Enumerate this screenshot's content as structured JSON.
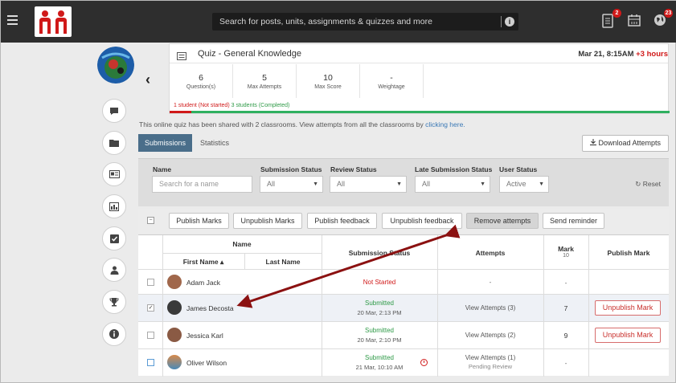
{
  "topbar": {
    "search_placeholder": "Search for posts, units, assignments & quizzes and more",
    "notifications_badge": "2",
    "alerts_badge": "23",
    "colors": {
      "bar": "#2e2e2e",
      "logo": "#d01919"
    }
  },
  "quiz": {
    "title": "Quiz - General Knowledge",
    "date": "Mar 21, 8:15AM",
    "extra_time": "+3 hours",
    "stats": [
      {
        "value": "6",
        "label": "Question(s)"
      },
      {
        "value": "5",
        "label": "Max Attempts"
      },
      {
        "value": "10",
        "label": "Max Score"
      },
      {
        "value": "-",
        "label": "Weightage"
      }
    ],
    "status_not_started": "1 student (Not started)",
    "status_completed": "3 students (Completed)"
  },
  "shared_note": {
    "text": "This online quiz has been shared with 2 classrooms. View attempts from all the classrooms by ",
    "link": "clicking here."
  },
  "tabs": {
    "submissions": "Submissions",
    "statistics": "Statistics"
  },
  "download_label": "Download Attempts",
  "filters": {
    "name_label": "Name",
    "name_placeholder": "Search for a name",
    "submission_status_label": "Submission Status",
    "submission_status_value": "All",
    "review_status_label": "Review Status",
    "review_status_value": "All",
    "late_status_label": "Late Submission Status",
    "late_status_value": "All",
    "user_status_label": "User Status",
    "user_status_value": "Active",
    "reset_label": "Reset"
  },
  "actions": [
    "Publish Marks",
    "Unpublish Marks",
    "Publish feedback",
    "Unpublish feedback",
    "Remove attempts",
    "Send reminder"
  ],
  "table": {
    "headers": {
      "name": "Name",
      "first_name": "First Name ▴",
      "last_name": "Last Name",
      "submission_status": "Submission Status",
      "attempts": "Attempts",
      "mark": "Mark",
      "mark_max": "10",
      "publish_mark": "Publish Mark"
    },
    "rows": [
      {
        "name": "Adam Jack",
        "status": "Not Started",
        "date": "",
        "attempts": "-",
        "pending": "",
        "mark": "-",
        "publish": "",
        "checked": false
      },
      {
        "name": "James Decosta",
        "status": "Submitted",
        "date": "20 Mar, 2:13 PM",
        "attempts": "View Attempts (3)",
        "pending": "",
        "mark": "7",
        "publish": "Unpublish Mark",
        "checked": true
      },
      {
        "name": "Jessica Karl",
        "status": "Submitted",
        "date": "20 Mar, 2:10 PM",
        "attempts": "View Attempts (2)",
        "pending": "",
        "mark": "9",
        "publish": "Unpublish Mark",
        "checked": false
      },
      {
        "name": "Oliver Wilson",
        "status": "Submitted",
        "date": "21 Mar, 10:10 AM",
        "attempts": "View Attempts (1)",
        "pending": "Pending Review",
        "mark": "-",
        "publish": "",
        "checked": false
      }
    ]
  },
  "rail_icons": [
    "chat-icon",
    "folder-icon",
    "id-card-icon",
    "bar-chart-icon",
    "checkbox-icon",
    "user-icon",
    "trophy-icon",
    "info-icon"
  ]
}
